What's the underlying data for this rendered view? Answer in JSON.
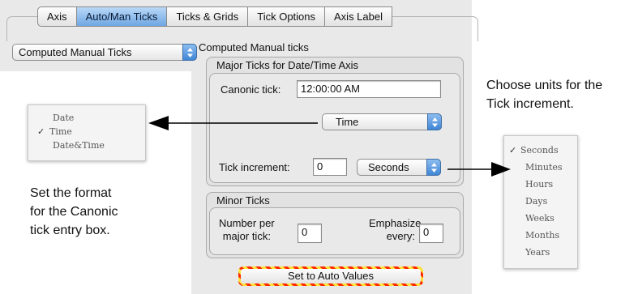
{
  "tabs": [
    "Axis",
    "Auto/Man Ticks",
    "Ticks & Grids",
    "Tick Options",
    "Axis Label"
  ],
  "active_tab": "Auto/Man Ticks",
  "tick_mode_popup": "Computed Manual Ticks",
  "section_title": "Computed Manual ticks",
  "major_group_title": "Major Ticks for Date/Time Axis",
  "canonic_tick": {
    "label": "Canonic tick:",
    "value": "12:00:00 AM"
  },
  "format_popup": "Time",
  "tick_increment": {
    "label": "Tick increment:",
    "value": "0"
  },
  "units_popup": "Seconds",
  "minor_group_title": "Minor Ticks",
  "number_per_major": {
    "label_line1": "Number per",
    "label_line2": "major tick:",
    "value": "0"
  },
  "emphasize_every": {
    "label_line1": "Emphasize",
    "label_line2": "every:",
    "value": "0"
  },
  "auto_values_button": "Set to Auto Values",
  "format_menu": {
    "partial_item": "",
    "items": [
      "Date",
      "Time",
      "Date&Time"
    ],
    "checked": "Time"
  },
  "units_menu": {
    "items": [
      "Seconds",
      "Minutes",
      "Hours",
      "Days",
      "Weeks",
      "Months",
      "Years"
    ],
    "checked": "Seconds"
  },
  "caption_format": [
    "Set the format",
    "for the Canonic",
    "tick entry box."
  ],
  "caption_units": [
    "Choose units for the",
    "Tick increment."
  ],
  "icons": {
    "popup_arrows": "up-down-arrows-icon",
    "checkmark": "checkmark-icon"
  },
  "colors": {
    "active_tab": "#6fa7e3",
    "popup_arrows": "#3f86d6",
    "button_stripe_red": "#ff2a00",
    "button_stripe_yellow": "#ffe23a"
  }
}
